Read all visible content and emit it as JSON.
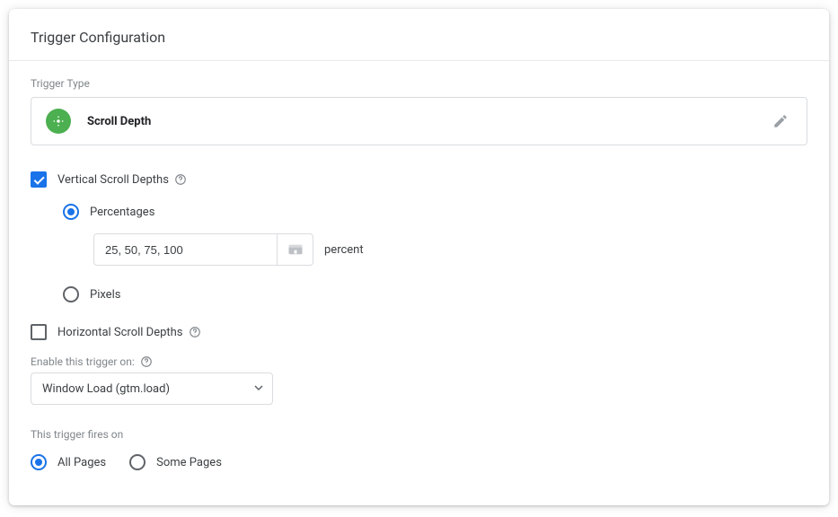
{
  "card_title": "Trigger Configuration",
  "trigger_type_label": "Trigger Type",
  "trigger_type": {
    "name": "Scroll Depth"
  },
  "vertical": {
    "label": "Vertical Scroll Depths",
    "checked": true,
    "percentages": {
      "label": "Percentages",
      "selected": true,
      "value": "25, 50, 75, 100",
      "unit": "percent"
    },
    "pixels": {
      "label": "Pixels",
      "selected": false
    }
  },
  "horizontal": {
    "label": "Horizontal Scroll Depths",
    "checked": false
  },
  "enable": {
    "label": "Enable this trigger on:",
    "value": "Window Load (gtm.load)"
  },
  "fires": {
    "label": "This trigger fires on",
    "all_pages": {
      "label": "All Pages",
      "selected": true
    },
    "some_pages": {
      "label": "Some Pages",
      "selected": false
    }
  }
}
